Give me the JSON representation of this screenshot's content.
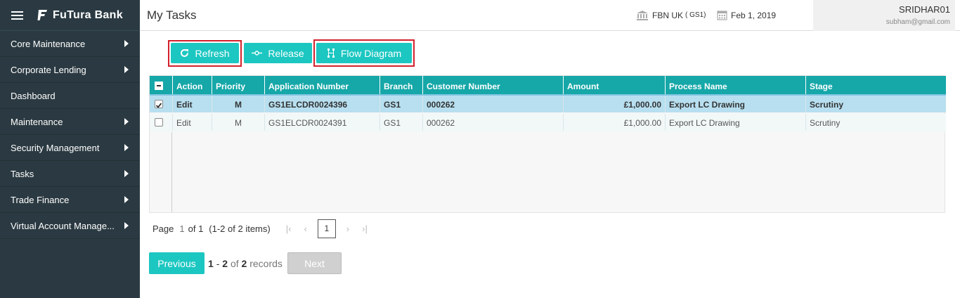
{
  "app": {
    "brand": "FuTura Bank"
  },
  "sidebar": {
    "items": [
      {
        "label": "Core Maintenance",
        "has_arrow": true
      },
      {
        "label": "Corporate Lending",
        "has_arrow": true
      },
      {
        "label": "Dashboard",
        "has_arrow": false
      },
      {
        "label": "Maintenance",
        "has_arrow": true
      },
      {
        "label": "Security Management",
        "has_arrow": true
      },
      {
        "label": "Tasks",
        "has_arrow": true
      },
      {
        "label": "Trade Finance",
        "has_arrow": true
      },
      {
        "label": "Virtual Account Manage...",
        "has_arrow": true
      }
    ]
  },
  "header": {
    "title": "My Tasks",
    "branch": "FBN UK",
    "branch_code": "( GS1)",
    "date": "Feb 1, 2019",
    "user": "SRIDHAR01",
    "email": "subham@gmail.com"
  },
  "toolbar": {
    "refresh": "Refresh",
    "release": "Release",
    "flow_diagram": "Flow Diagram"
  },
  "table": {
    "columns": [
      "Action",
      "Priority",
      "Application Number",
      "Branch",
      "Customer Number",
      "Amount",
      "Process Name",
      "Stage"
    ],
    "rows": [
      {
        "checked": true,
        "action": "Edit",
        "priority": "M",
        "application_number": "GS1ELCDR0024396",
        "branch": "GS1",
        "customer_number": "000262",
        "amount": "£1,000.00",
        "process_name": "Export LC Drawing",
        "stage": "Scrutiny"
      },
      {
        "checked": false,
        "action": "Edit",
        "priority": "M",
        "application_number": "GS1ELCDR0024391",
        "branch": "GS1",
        "customer_number": "000262",
        "amount": "£1,000.00",
        "process_name": "Export LC Drawing",
        "stage": "Scrutiny"
      }
    ]
  },
  "pager": {
    "page_label": "Page",
    "page": "1",
    "of_label": "of 1",
    "items_summary": "(1-2 of 2 items)",
    "current": "1"
  },
  "records": {
    "previous": "Previous",
    "next": "Next",
    "from": "1",
    "dash": "-",
    "to": "2",
    "of": "of",
    "total": "2",
    "label": "records"
  },
  "colors": {
    "accent": "#1cc7c1",
    "grid_header": "#16a7a8",
    "sidebar": "#2b3a42",
    "highlight": "#d2222d"
  }
}
